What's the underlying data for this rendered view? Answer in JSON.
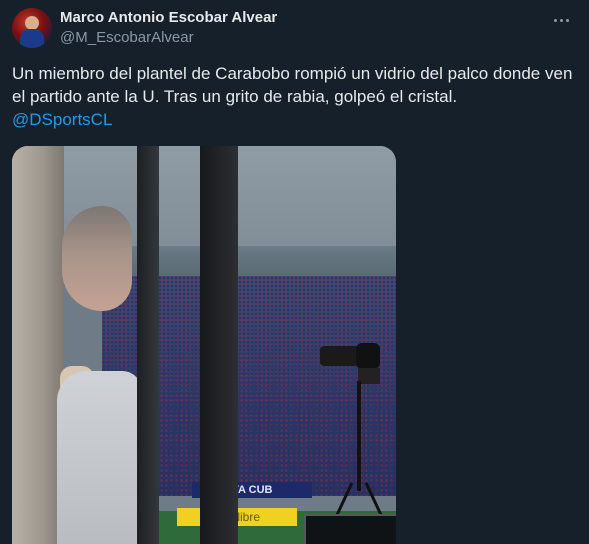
{
  "author": {
    "display_name": "Marco Antonio Escobar Alvear",
    "handle": "@M_EscobarAlvear"
  },
  "more_icon": "more-horizontal-icon",
  "tweet": {
    "text": "Un miembro del plantel de Carabobo rompió un vidrio del palco donde ven el partido ante la U. Tras un grito de rabia, golpeó el cristal.",
    "mention": "@DSportsCL"
  },
  "media": {
    "adboard_text": "VA CUB",
    "adboard2_text": "ado libre"
  },
  "colors": {
    "background": "#15202b",
    "text": "#e7e9ea",
    "secondary": "#8b98a5",
    "link": "#1d9bf0"
  }
}
